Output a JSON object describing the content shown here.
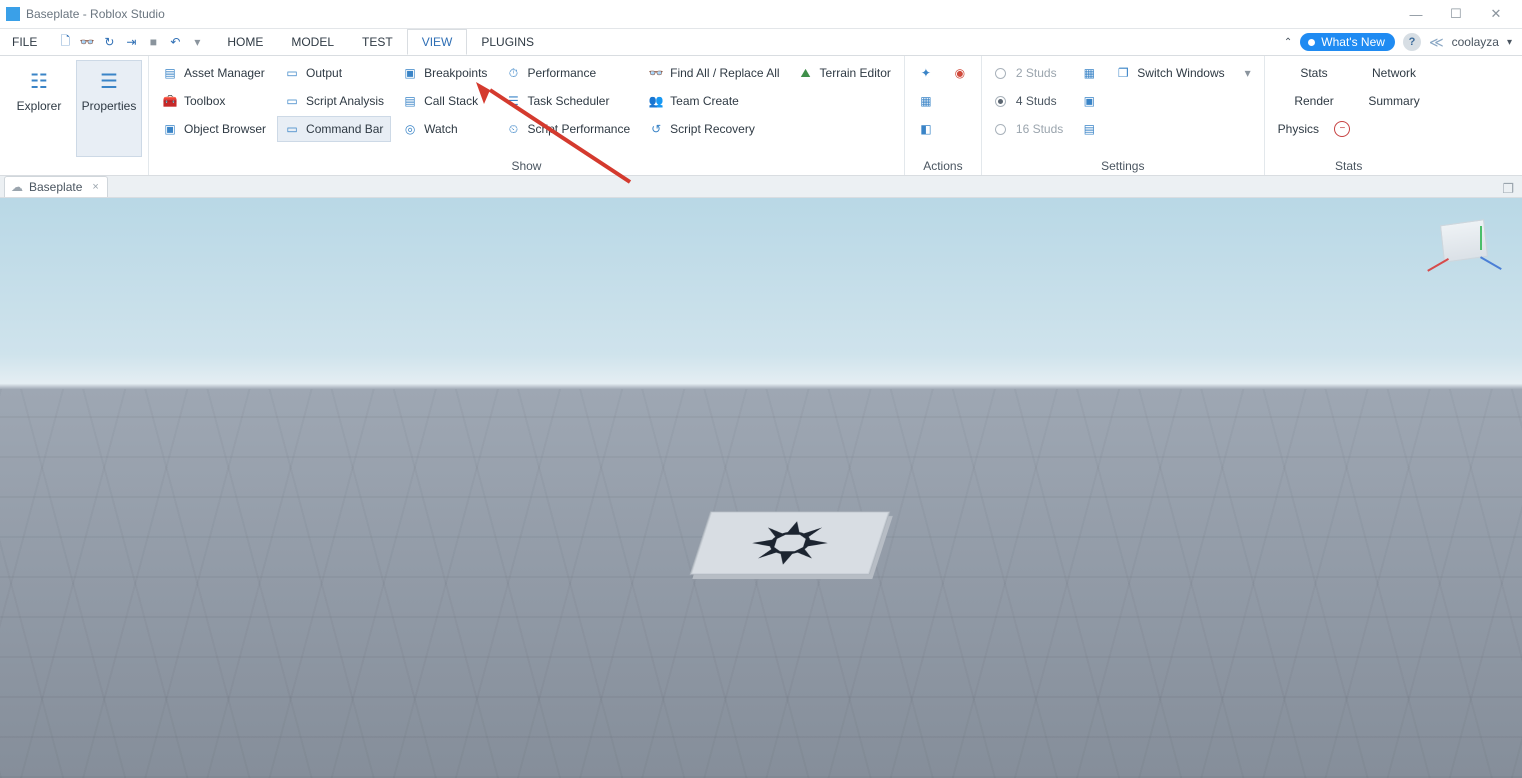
{
  "window": {
    "title": "Baseplate - Roblox Studio",
    "controls": {
      "min": "—",
      "max": "☐",
      "close": "✕"
    }
  },
  "menu": {
    "file": "FILE",
    "tabs": [
      "HOME",
      "MODEL",
      "TEST",
      "VIEW",
      "PLUGINS"
    ],
    "active_tab_index": 3,
    "collapse_glyph": "⌃",
    "whats_new": "What's New",
    "help_glyph": "?",
    "share_glyph": "≪",
    "username": "coolayza",
    "user_caret": "▾"
  },
  "quick_access": [
    {
      "name": "new-icon",
      "glyph": "🗋"
    },
    {
      "name": "open-icon",
      "glyph": "👓"
    },
    {
      "name": "redo-icon",
      "glyph": "↻"
    },
    {
      "name": "publish-icon",
      "glyph": "⇥"
    },
    {
      "name": "stop-icon",
      "glyph": "■"
    },
    {
      "name": "undo-icon",
      "glyph": "↶"
    },
    {
      "name": "more-icon",
      "glyph": "▾"
    }
  ],
  "ribbon": {
    "explorer": "Explorer",
    "properties": "Properties",
    "show": {
      "label": "Show",
      "items": {
        "asset_manager": "Asset Manager",
        "toolbox": "Toolbox",
        "object_browser": "Object Browser",
        "output": "Output",
        "script_analysis": "Script Analysis",
        "command_bar": "Command Bar",
        "breakpoints": "Breakpoints",
        "call_stack": "Call Stack",
        "watch": "Watch",
        "performance": "Performance",
        "task_scheduler": "Task Scheduler",
        "script_performance": "Script Performance",
        "find_all": "Find All / Replace All",
        "team_create": "Team Create",
        "script_recovery": "Script Recovery",
        "terrain_editor": "Terrain Editor"
      }
    },
    "actions": {
      "label": "Actions"
    },
    "settings": {
      "label": "Settings",
      "grid": {
        "two": "2 Studs",
        "four": "4 Studs",
        "sixteen": "16 Studs",
        "selected": "four"
      },
      "switch_windows": "Switch Windows"
    },
    "stats": {
      "label": "Stats",
      "stats": "Stats",
      "network": "Network",
      "render": "Render",
      "summary": "Summary",
      "physics": "Physics"
    }
  },
  "doc_tab": {
    "name": "Baseplate",
    "close": "×",
    "cloud": "☁"
  }
}
